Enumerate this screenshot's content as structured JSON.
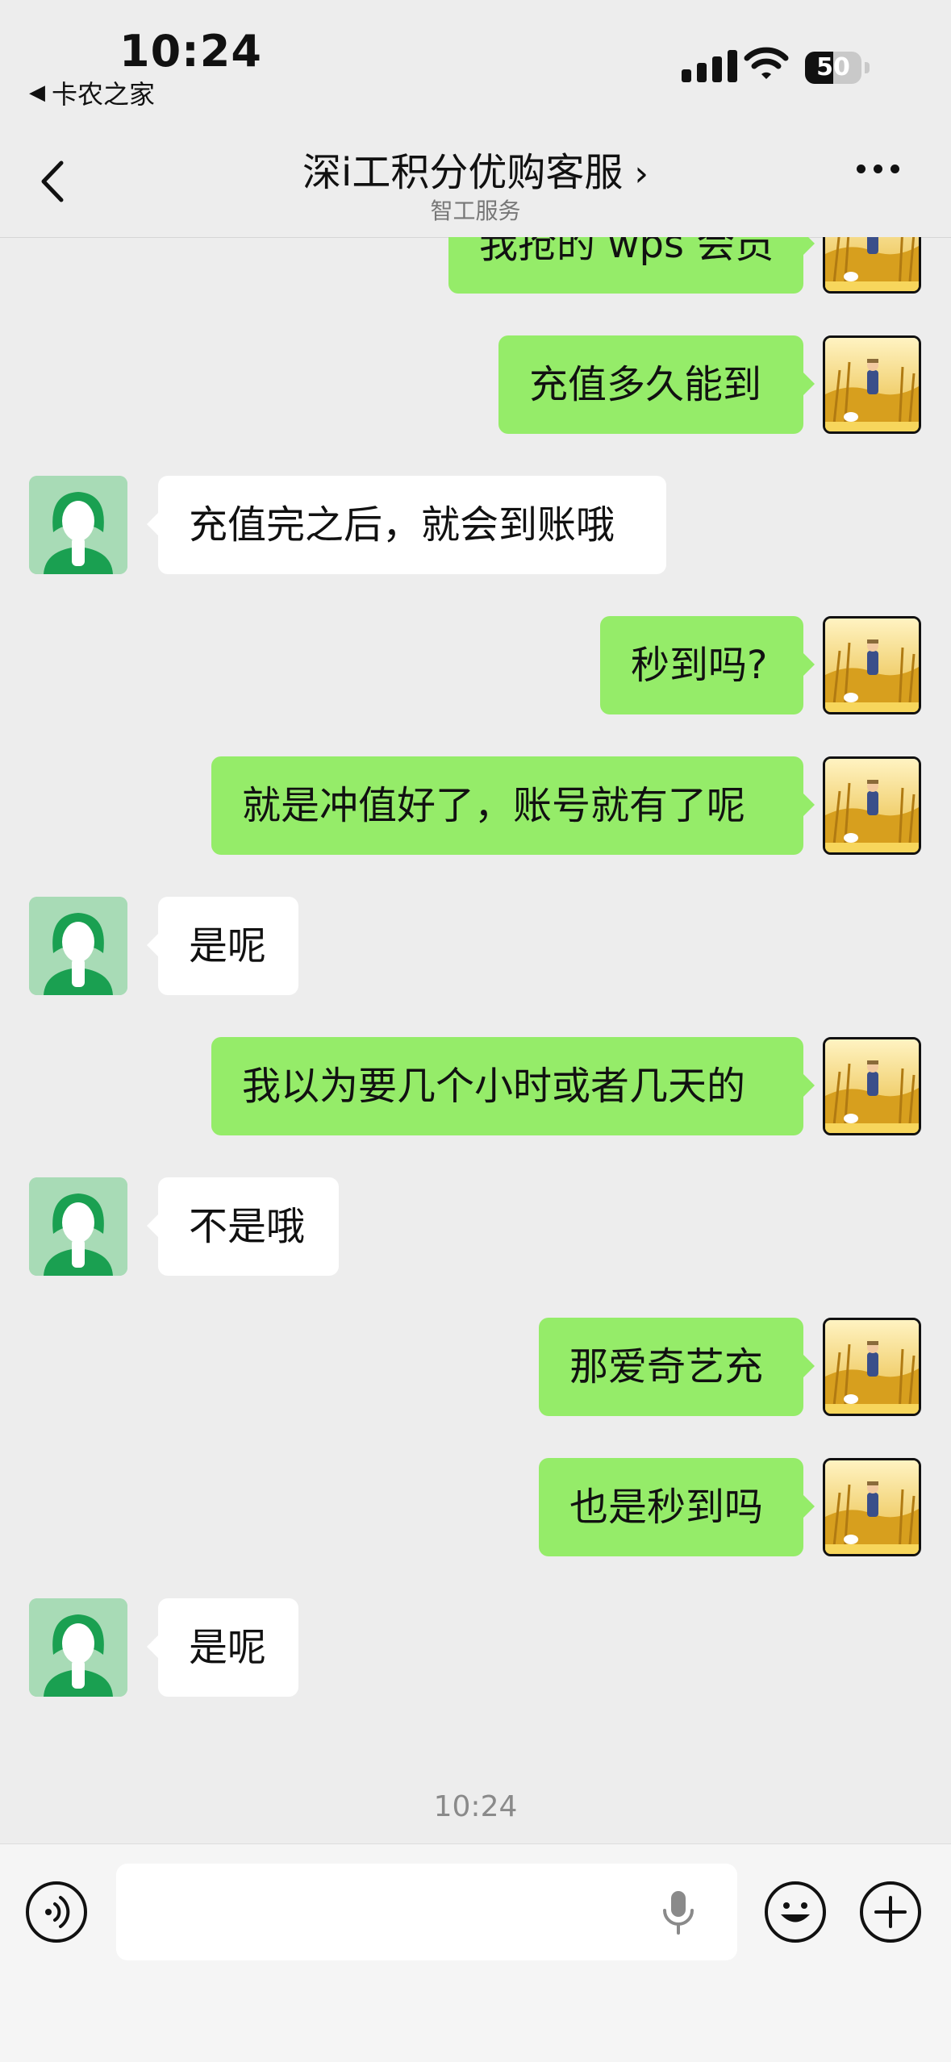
{
  "status_bar": {
    "time": "10:24",
    "back_app": "卡农之家",
    "battery": "50",
    "battery_level": 0.5
  },
  "nav": {
    "title": "深i工积分优购客服",
    "subtitle": "智工服务"
  },
  "messages": [
    {
      "side": "me",
      "text": "我抢的 wps 会员"
    },
    {
      "side": "me",
      "text": "充值多久能到"
    },
    {
      "side": "them",
      "text": "充值完之后，就会到账哦"
    },
    {
      "side": "me",
      "text": "秒到吗?"
    },
    {
      "side": "me",
      "text": "就是冲值好了，账号就有了呢"
    },
    {
      "side": "them",
      "text": "是呢"
    },
    {
      "side": "me",
      "text": "我以为要几个小时或者几天的"
    },
    {
      "side": "them",
      "text": "不是哦"
    },
    {
      "side": "me",
      "text": "那爱奇艺充"
    },
    {
      "side": "me",
      "text": "也是秒到吗"
    },
    {
      "side": "them",
      "text": "是呢"
    }
  ],
  "timestamp": "10:24",
  "input": {
    "value": "",
    "placeholder": ""
  },
  "colors": {
    "my_bubble": "#95ec69",
    "their_bubble": "#ffffff",
    "background": "#ededed",
    "agent_avatar_bg": "#a8dbb6",
    "agent_avatar_fg": "#1aa051"
  },
  "icons": {
    "voice": "voice-mode-icon",
    "mic": "microphone-icon",
    "emoji": "emoji-icon",
    "more": "plus-icon"
  }
}
